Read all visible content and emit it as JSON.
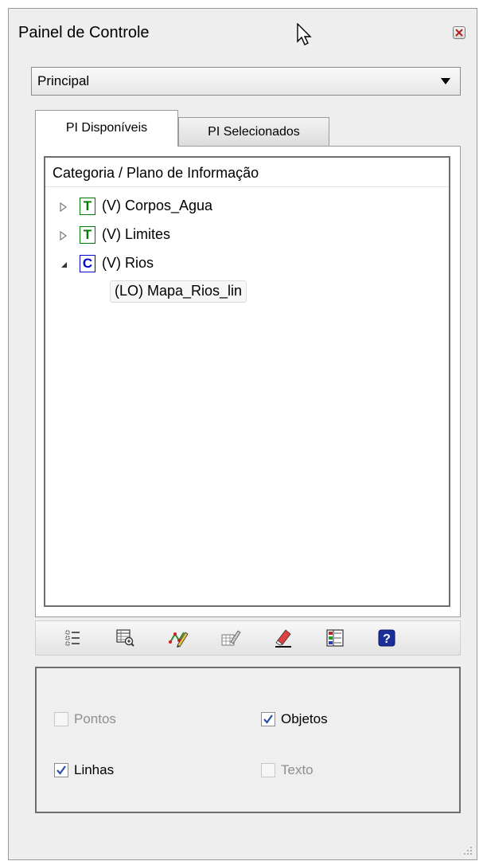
{
  "window": {
    "title": "Painel de Controle",
    "close_icon": "close-icon"
  },
  "view_selector": {
    "selected": "Principal",
    "icon": "chevron-down-icon"
  },
  "tabs": [
    {
      "label": "PI Disponíveis",
      "active": true
    },
    {
      "label": "PI Selecionados",
      "active": false
    }
  ],
  "tree": {
    "header": "Categoria / Plano de Informação",
    "items": [
      {
        "type_letter": "T",
        "label": "(V) Corpos_Agua",
        "expanded": false,
        "type_color": "#007a00",
        "border_color": "#007a00"
      },
      {
        "type_letter": "T",
        "label": "(V) Limites",
        "expanded": false,
        "type_color": "#007a00",
        "border_color": "#007a00"
      },
      {
        "type_letter": "C",
        "label": "(V) Rios",
        "expanded": true,
        "type_color": "#0000d0",
        "border_color": "#0000d0"
      }
    ],
    "child": {
      "label": "(LO) Mapa_Rios_lin"
    }
  },
  "toolbar": {
    "icons": [
      "list-icon",
      "table-zoom-icon",
      "edit-vector-icon",
      "edit-table-icon",
      "eraser-icon",
      "legend-icon",
      "help-icon"
    ]
  },
  "options": [
    {
      "label": "Pontos",
      "checked": false,
      "enabled": false
    },
    {
      "label": "Objetos",
      "checked": true,
      "enabled": true
    },
    {
      "label": "Linhas",
      "checked": true,
      "enabled": true
    },
    {
      "label": "Texto",
      "checked": false,
      "enabled": false
    }
  ],
  "colors": {
    "panel_bg": "#eeeeee",
    "check_blue": "#2a4fa8"
  }
}
